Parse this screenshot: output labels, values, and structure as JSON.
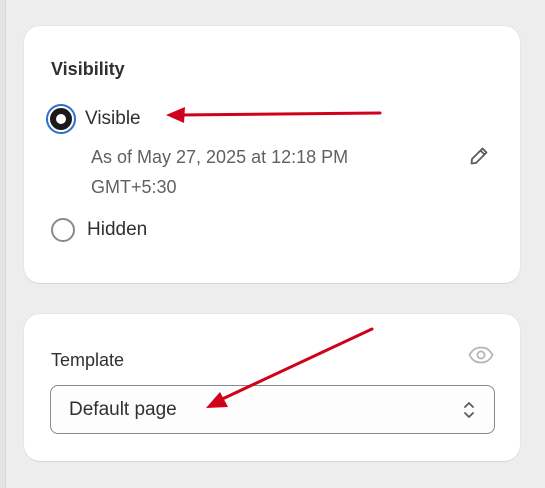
{
  "visibility": {
    "title": "Visibility",
    "options": [
      {
        "label": "Visible",
        "selected": true
      },
      {
        "label": "Hidden",
        "selected": false
      }
    ],
    "schedule_line1": "As of May 27, 2025 at 12:18 PM",
    "schedule_line2": "GMT+5:30",
    "edit_icon": "pencil-icon"
  },
  "template": {
    "label": "Template",
    "preview_icon": "eye-icon",
    "selected_value": "Default page",
    "select_icon": "chevron-up-down-icon"
  },
  "colors": {
    "annotation_arrow": "#d0021b",
    "radio_focus": "#2c6ecb"
  }
}
